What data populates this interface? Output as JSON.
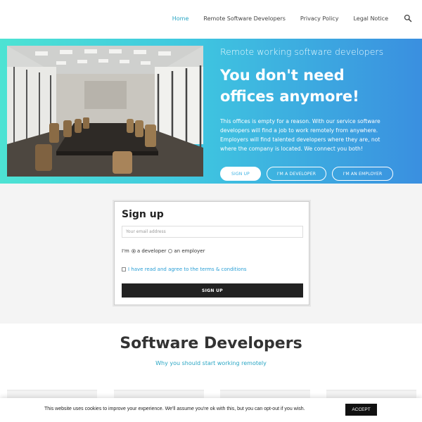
{
  "nav": {
    "items": [
      {
        "label": "Home",
        "active": true
      },
      {
        "label": "Remote Software Developers",
        "active": false
      },
      {
        "label": "Privacy Policy",
        "active": false
      },
      {
        "label": "Legal Notice",
        "active": false
      }
    ],
    "search_icon": "search-icon"
  },
  "hero": {
    "subtitle": "Remote working software developers",
    "title": "You don't need offices anymore!",
    "text": "This offices is empty for a reason. With our service software developers will find a job to work remotely from anywhere. Employers will find talented developers where they are, not where the company is located. We connect you both!",
    "buttons": {
      "signup": "SIGN UP",
      "developer": "I'M A DEVELOPER",
      "employer": "I'M AN EMPLOYER"
    },
    "colors": {
      "gradient_start": "#4de3d3",
      "gradient_end": "#3a8fe0"
    }
  },
  "signup": {
    "title": "Sign up",
    "email_placeholder": "Your email address",
    "im_label": "I'm",
    "option_developer": "a developer",
    "option_employer": "an employer",
    "selected_option": "a developer",
    "terms_label": "I have read and agree to the terms & conditions",
    "submit_label": "SIGN UP"
  },
  "developers_section": {
    "title": "Software Developers",
    "subtitle": "Why you should start working remotely"
  },
  "cookie": {
    "text": "This website uses cookies to improve your experience. We'll assume you're ok with this, but you can opt-out if you wish.",
    "accept_label": "ACCEPT"
  }
}
